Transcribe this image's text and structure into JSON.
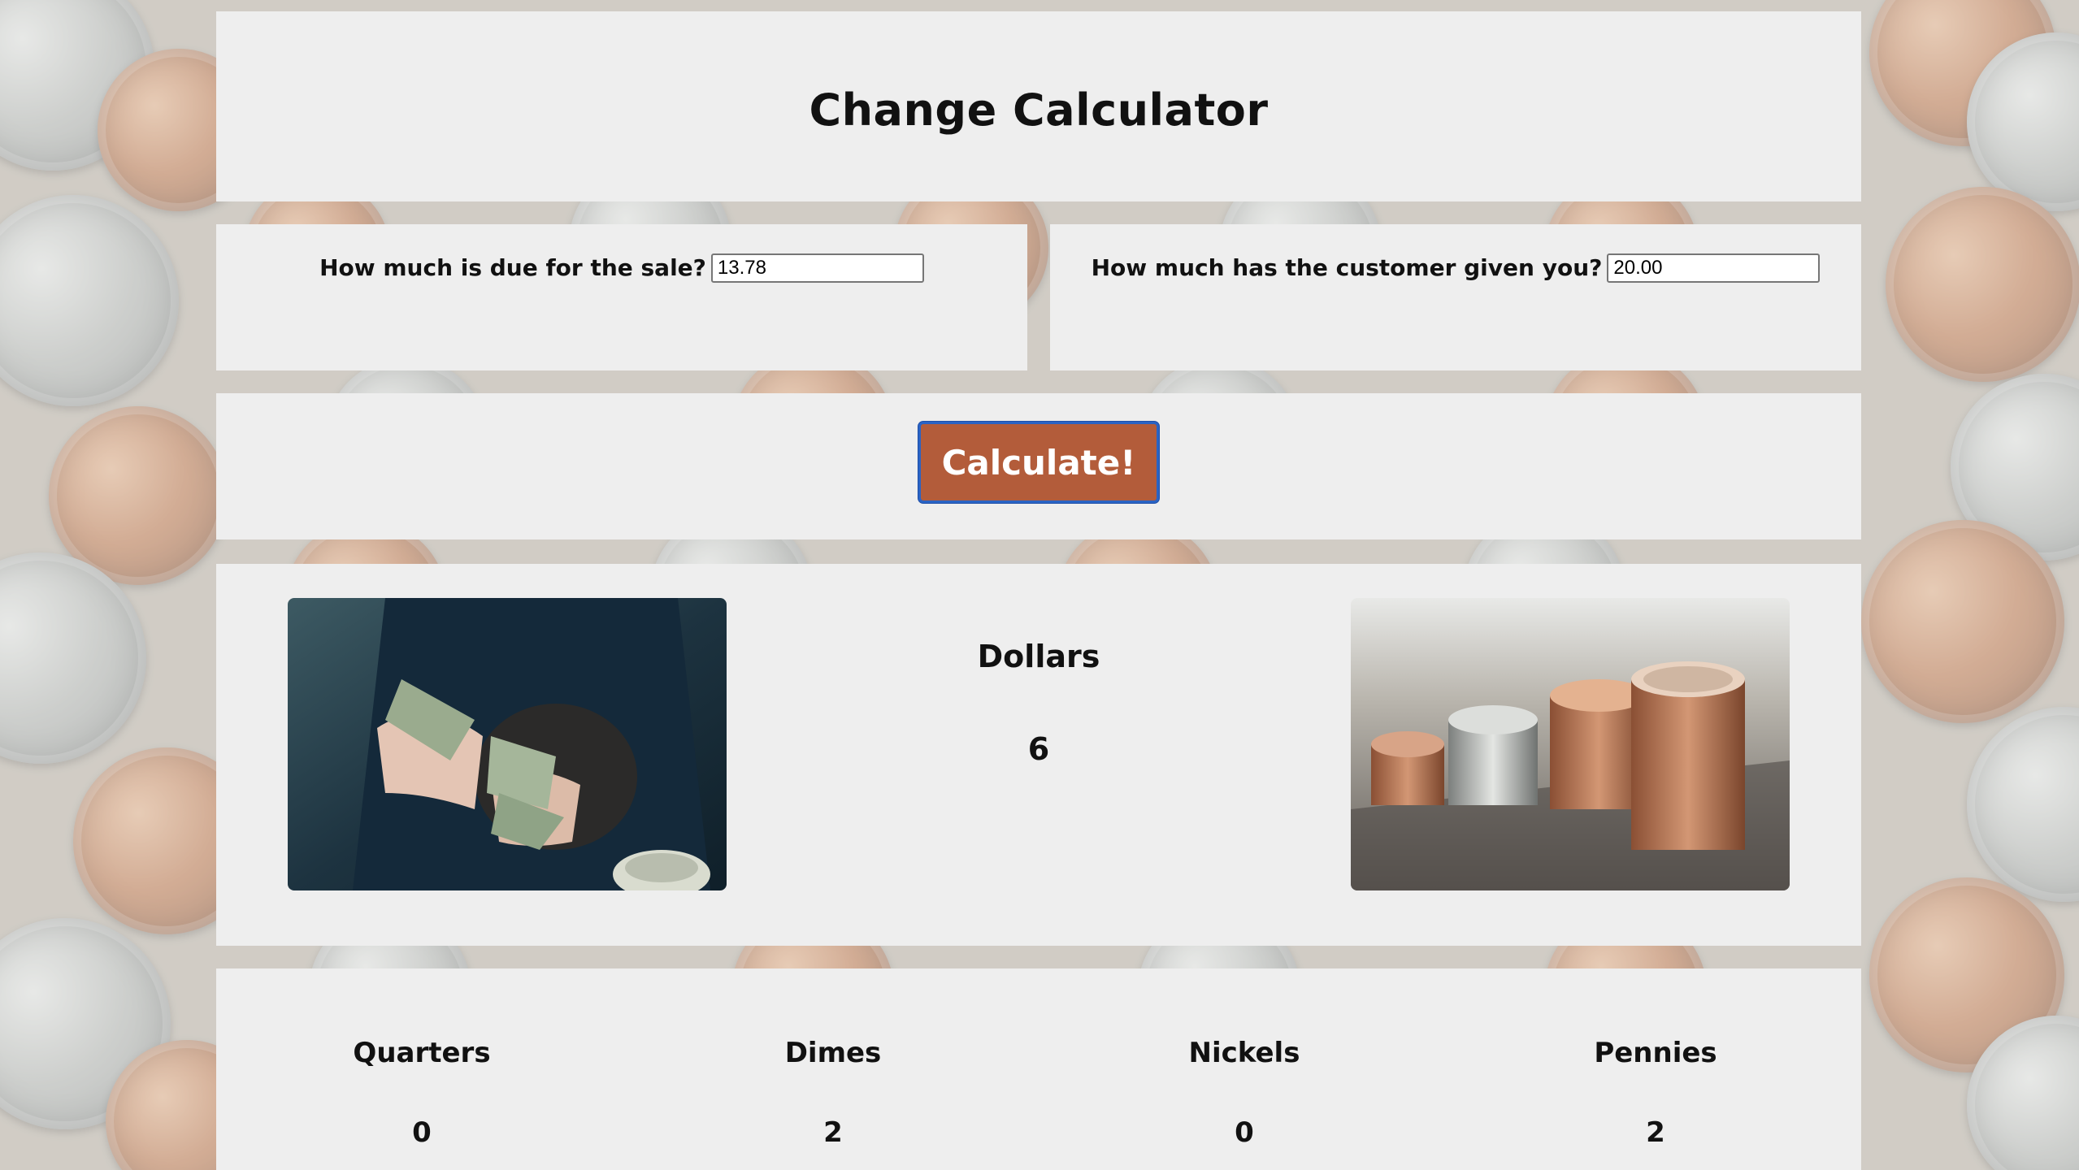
{
  "header": {
    "title": "Change Calculator"
  },
  "inputs": {
    "amount_due_label": "How much is due for the sale?",
    "amount_due_value": "13.78",
    "amount_received_label": "How much has the customer given you?",
    "amount_received_value": "20.00"
  },
  "actions": {
    "calculate_label": "Calculate!"
  },
  "results": {
    "dollars": {
      "label": "Dollars",
      "count": "6"
    },
    "coins": [
      {
        "label": "Quarters",
        "count": "0"
      },
      {
        "label": "Dimes",
        "count": "2"
      },
      {
        "label": "Nickels",
        "count": "0"
      },
      {
        "label": "Pennies",
        "count": "2"
      }
    ]
  },
  "images": {
    "left": "person-counting-cash-photo",
    "right": "stacked-coins-photo"
  },
  "colors": {
    "panel": "#eeeeee",
    "button": "#b35c3a",
    "button_border": "#2a63c4"
  }
}
